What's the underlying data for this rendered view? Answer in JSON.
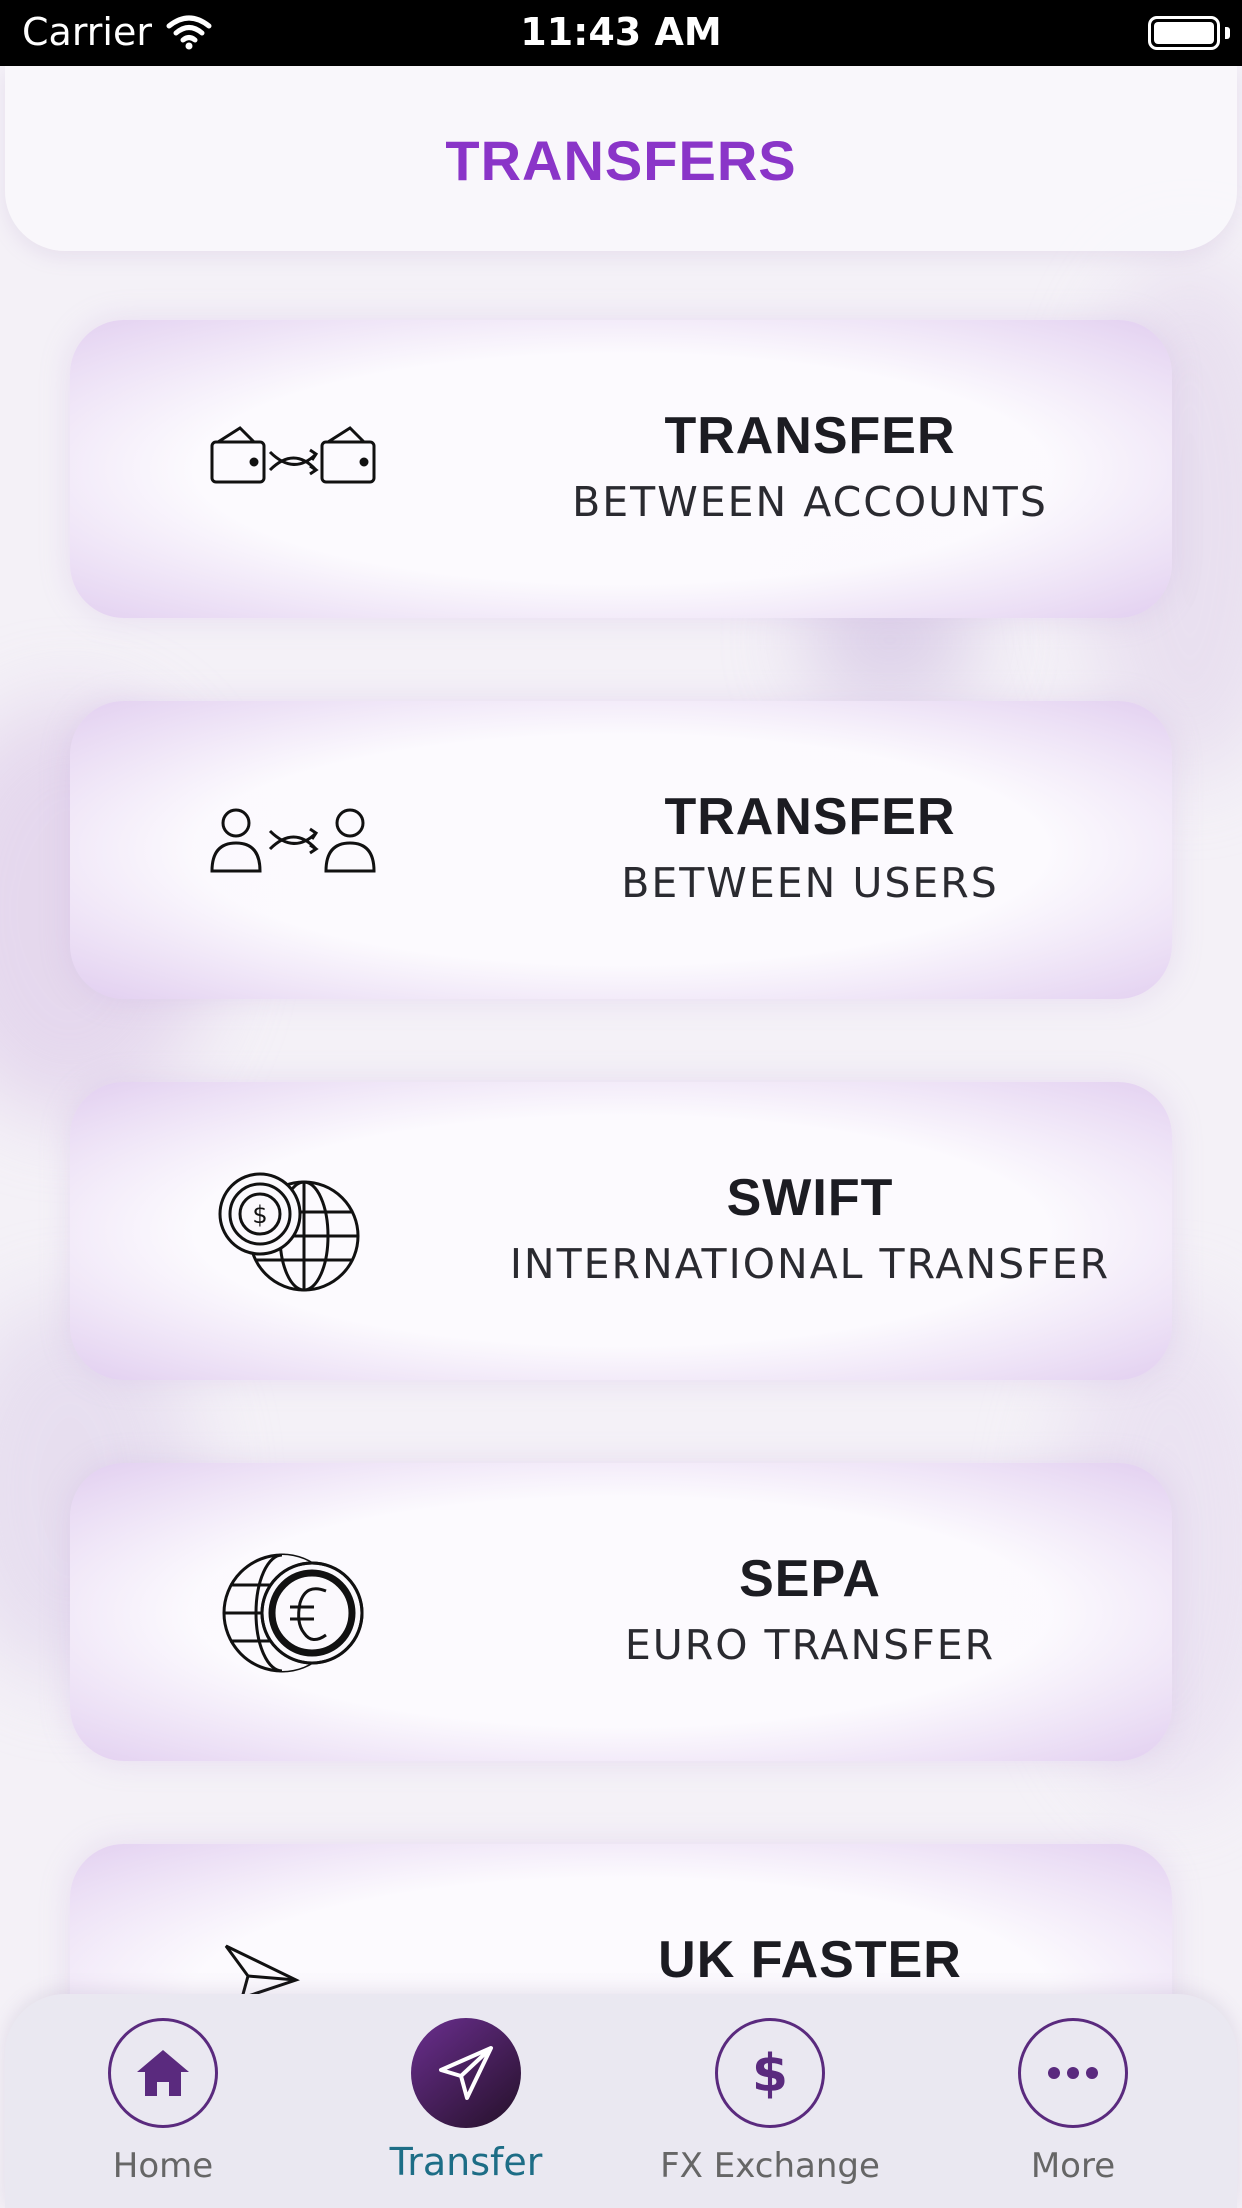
{
  "status_bar": {
    "carrier": "Carrier",
    "time": "11:43 AM"
  },
  "header": {
    "title": "TRANSFERS"
  },
  "colors": {
    "accent": "#8a35c8",
    "dark_purple": "#5a2a7e",
    "active_tab_label": "#1d6d86"
  },
  "cards": [
    {
      "icon": "wallet-transfer-icon",
      "title": "TRANSFER",
      "subtitle": "BETWEEN ACCOUNTS"
    },
    {
      "icon": "users-transfer-icon",
      "title": "TRANSFER",
      "subtitle": "BETWEEN USERS"
    },
    {
      "icon": "coin-globe-icon",
      "title": "SWIFT",
      "subtitle": "INTERNATIONAL TRANSFER"
    },
    {
      "icon": "euro-globe-icon",
      "title": "SEPA",
      "subtitle": "EURO TRANSFER"
    },
    {
      "icon": "paper-plane-icon",
      "title": "UK FASTER",
      "subtitle": ""
    }
  ],
  "tabbar": {
    "tabs": [
      {
        "label": "Home",
        "icon": "home-icon",
        "active": false
      },
      {
        "label": "Transfer",
        "icon": "paper-plane-icon",
        "active": true
      },
      {
        "label": "FX Exchange",
        "icon": "dollar-icon",
        "active": false
      },
      {
        "label": "More",
        "icon": "more-dots-icon",
        "active": false
      }
    ]
  }
}
